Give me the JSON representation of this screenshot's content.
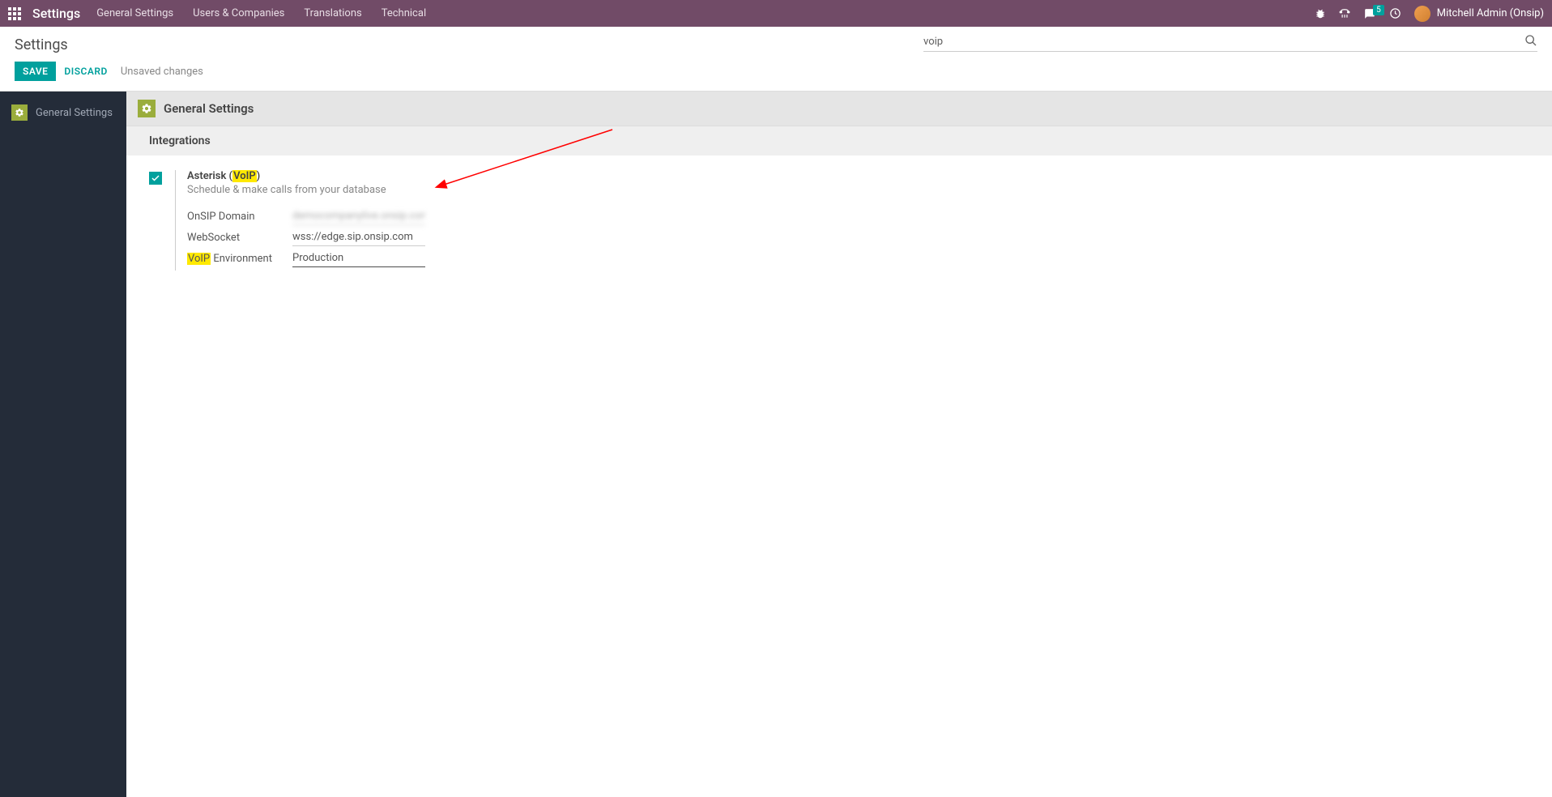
{
  "topNav": {
    "title": "Settings",
    "menuItems": [
      "General Settings",
      "Users & Companies",
      "Translations",
      "Technical"
    ],
    "messageBadge": "5",
    "userName": "Mitchell Admin (Onsip)"
  },
  "subHeader": {
    "breadcrumb": "Settings",
    "saveLabel": "SAVE",
    "discardLabel": "DISCARD",
    "unsavedText": "Unsaved changes",
    "searchValue": "voip"
  },
  "sidebar": {
    "items": [
      {
        "label": "General Settings"
      }
    ]
  },
  "content": {
    "sectionTitle": "General Settings",
    "subsectionTitle": "Integrations",
    "setting": {
      "titlePrefix": "Asterisk (",
      "titleHighlight": "VoIP",
      "titleSuffix": ")",
      "description": "Schedule & make calls from your database",
      "fields": {
        "onsipDomainLabel": "OnSIP Domain",
        "onsipDomainValue": "democompanylive.onsip.com",
        "websocketLabel": "WebSocket",
        "websocketValue": "wss://edge.sip.onsip.com",
        "envLabelPrefix": "VoIP",
        "envLabelSuffix": " Environment",
        "envValue": "Production"
      }
    }
  }
}
